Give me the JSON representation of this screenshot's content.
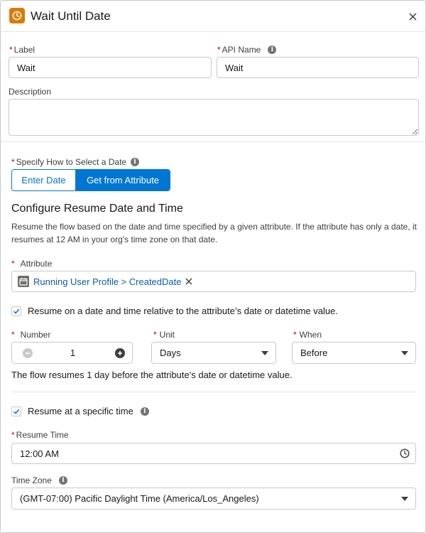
{
  "header": {
    "title": "Wait Until Date",
    "icon": "clock-icon",
    "icon_color": "#dd7a01",
    "close_icon": "close-icon"
  },
  "form": {
    "label": {
      "label": "Label",
      "value": "Wait"
    },
    "api_name": {
      "label": "API Name",
      "value": "Wait"
    },
    "description": {
      "label": "Description",
      "value": ""
    },
    "specify_date": {
      "label": "Specify How to Select a Date",
      "options": [
        "Enter Date",
        "Get from Attribute"
      ],
      "selected": "Get from Attribute"
    },
    "section_title": "Configure Resume Date and Time",
    "section_desc": "Resume the flow based on the date and time specified by a given attribute. If the attribute has only a date, it resumes at 12 AM in your org's time zone on that date.",
    "attribute": {
      "label": "Attribute",
      "value": "Running User Profile > CreatedDate"
    },
    "relative_checkbox": {
      "label": "Resume on a date and time relative to the attribute’s date or datetime value.",
      "checked": true
    },
    "number": {
      "label": "Number",
      "value": "1"
    },
    "unit": {
      "label": "Unit",
      "value": "Days"
    },
    "when": {
      "label": "When",
      "value": "Before"
    },
    "summary": "The flow resumes 1 day before the attribute's date or datetime value.",
    "specific_time_checkbox": {
      "label": "Resume at a specific time",
      "checked": true
    },
    "resume_time": {
      "label": "Resume Time",
      "value": "12:00 AM"
    },
    "time_zone": {
      "label": "Time Zone",
      "value": "(GMT-07:00) Pacific Daylight Time (America/Los_Angeles)"
    }
  },
  "colors": {
    "brand": "#0176d3",
    "required": "#ba0517",
    "link": "#0b5cab"
  }
}
